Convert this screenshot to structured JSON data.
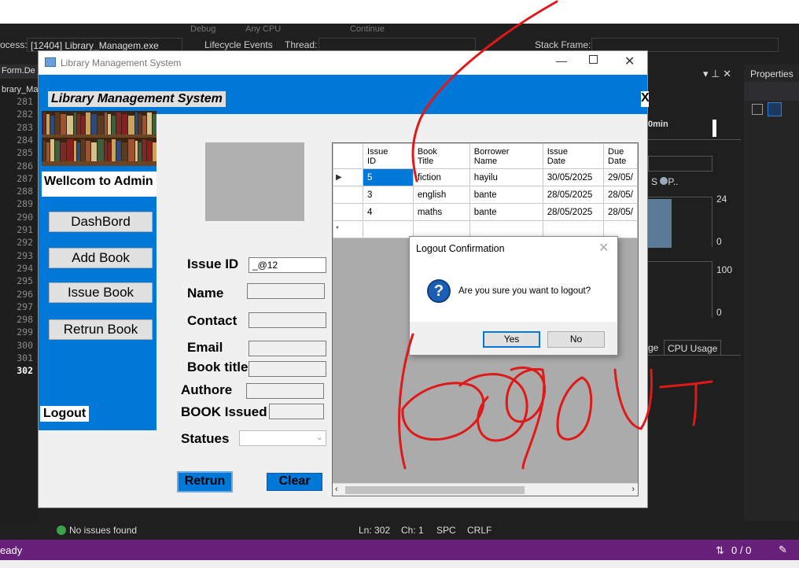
{
  "ide": {
    "toolbar": {
      "config": "Debug",
      "platform": "Any CPU",
      "continue": "Continue"
    },
    "process_label": "ocess:",
    "process_value": "[12404] Library_Managem.exe",
    "lifecycle": "Lifecycle Events",
    "thread_label": "Thread:",
    "stackframe_label": "Stack Frame:",
    "tab_form": "Form.De",
    "tab_library": "brary_Ma",
    "line_numbers": [
      "281",
      "282",
      "283",
      "284",
      "285",
      "286",
      "287",
      "288",
      "289",
      "290",
      "291",
      "292",
      "293",
      "294",
      "295",
      "296",
      "297",
      "298",
      "299",
      "300",
      "301",
      "302"
    ],
    "right_panel": {
      "time": "0min",
      "legend_s": "S",
      "legend_p": "P..",
      "axis_24": "24",
      "axis_0a": "0",
      "axis_100": "100",
      "axis_0b": "0",
      "tab_usage": "ge",
      "tab_cpu": "CPU Usage"
    },
    "properties_title": "Properties",
    "status": {
      "issues": "No issues found",
      "ln": "Ln: 302",
      "ch": "Ch: 1",
      "spc": "SPC",
      "crlf": "CRLF",
      "ready": "eady",
      "git": "0 / 0"
    }
  },
  "app": {
    "window_title": "Library Management System",
    "header_title": "Library Management System",
    "header_close": "X",
    "welcome": "Wellcom to Admin",
    "nav": [
      "DashBord",
      "Add Book",
      "Issue Book",
      "Retrun Book"
    ],
    "logout": "Logout",
    "form": {
      "issue_id_label": "Issue ID",
      "issue_id_value": "_@12",
      "name_label": "Name",
      "contact_label": "Contact",
      "email_label": "Email",
      "book_title_label": "Book title",
      "author_label": "Authore",
      "book_issued_label": "BOOK Issued",
      "status_label": "Statues"
    },
    "buttons": {
      "retrun": "Retrun",
      "clear": "Clear"
    },
    "grid": {
      "columns": [
        "Issue ID",
        "Book Title",
        "Borrower Name",
        "Issue Date",
        "Due Date"
      ],
      "column_lines": [
        [
          "Issue",
          "ID"
        ],
        [
          "Book",
          "Title"
        ],
        [
          "Borrower",
          "Name"
        ],
        [
          "Issue",
          "Date"
        ],
        [
          "Due",
          "Date"
        ]
      ],
      "rows": [
        [
          "5",
          "fiction",
          "hayilu",
          "30/05/2025",
          "29/05/"
        ],
        [
          "3",
          "english",
          "bante",
          "28/05/2025",
          "28/05/"
        ],
        [
          "4",
          "maths",
          "bante",
          "28/05/2025",
          "28/05/"
        ]
      ],
      "new_row_marker": "*",
      "current_row_marker": "▶"
    }
  },
  "dialog": {
    "title": "Logout Confirmation",
    "message": "Are you sure you want to logout?",
    "yes": "Yes",
    "no": "No"
  },
  "annotation": {
    "color": "#e01818"
  }
}
